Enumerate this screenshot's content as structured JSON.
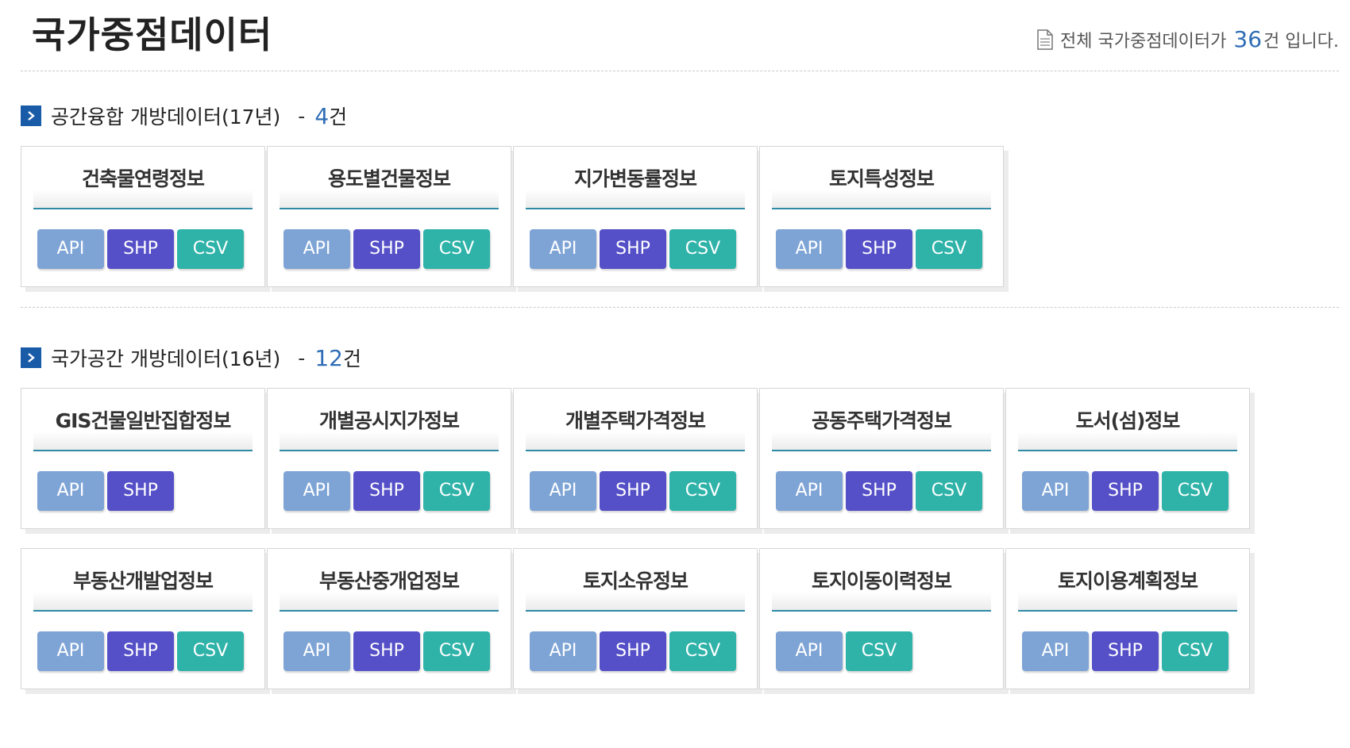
{
  "page": {
    "title": "국가중점데이터",
    "total_prefix": "전체 국가중점데이터가",
    "total_count": "36",
    "total_suffix": "건 입니다."
  },
  "icons": {
    "doc": "document-icon",
    "chevron": "chevron-right-icon"
  },
  "colors": {
    "api": "#7ea4d6",
    "shp": "#5550c7",
    "csv": "#2fb3a9",
    "accent": "#2f6db5",
    "section_marker": "#1a5ba8"
  },
  "sections": [
    {
      "title": "공간융합 개방데이터(17년)",
      "dash": "-",
      "count": "4",
      "count_unit": "건",
      "cards": [
        {
          "name": "건축물연령정보",
          "buttons": [
            "API",
            "SHP",
            "CSV"
          ]
        },
        {
          "name": "용도별건물정보",
          "buttons": [
            "API",
            "SHP",
            "CSV"
          ]
        },
        {
          "name": "지가변동률정보",
          "buttons": [
            "API",
            "SHP",
            "CSV"
          ]
        },
        {
          "name": "토지특성정보",
          "buttons": [
            "API",
            "SHP",
            "CSV"
          ]
        }
      ]
    },
    {
      "title": "국가공간 개방데이터(16년)",
      "dash": "-",
      "count": "12",
      "count_unit": "건",
      "cards": [
        {
          "name": "GIS건물일반집합정보",
          "buttons": [
            "API",
            "SHP"
          ]
        },
        {
          "name": "개별공시지가정보",
          "buttons": [
            "API",
            "SHP",
            "CSV"
          ]
        },
        {
          "name": "개별주택가격정보",
          "buttons": [
            "API",
            "SHP",
            "CSV"
          ]
        },
        {
          "name": "공동주택가격정보",
          "buttons": [
            "API",
            "SHP",
            "CSV"
          ]
        },
        {
          "name": "도서(섬)정보",
          "buttons": [
            "API",
            "SHP",
            "CSV"
          ]
        },
        {
          "name": "부동산개발업정보",
          "buttons": [
            "API",
            "SHP",
            "CSV"
          ]
        },
        {
          "name": "부동산중개업정보",
          "buttons": [
            "API",
            "SHP",
            "CSV"
          ]
        },
        {
          "name": "토지소유정보",
          "buttons": [
            "API",
            "SHP",
            "CSV"
          ]
        },
        {
          "name": "토지이동이력정보",
          "buttons": [
            "API",
            "CSV"
          ]
        },
        {
          "name": "토지이용계획정보",
          "buttons": [
            "API",
            "SHP",
            "CSV"
          ]
        }
      ]
    }
  ]
}
